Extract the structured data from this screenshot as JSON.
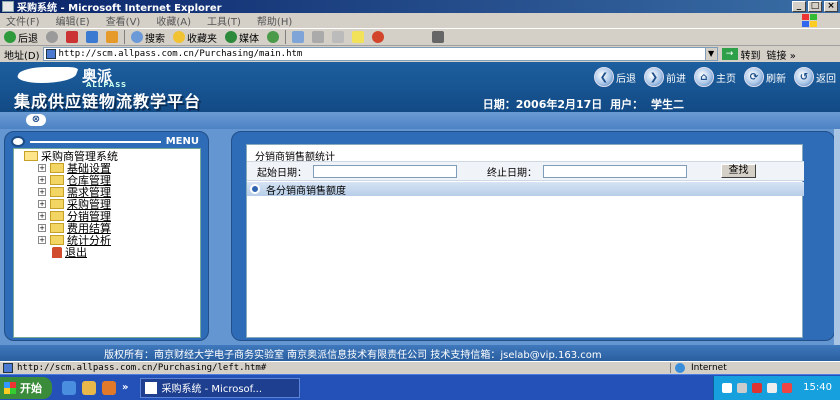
{
  "window": {
    "title": "采购系统 - Microsoft Internet Explorer",
    "min": "_",
    "max": "□",
    "close": "×"
  },
  "menubar": [
    "文件(F)",
    "编辑(E)",
    "查看(V)",
    "收藏(A)",
    "工具(T)",
    "帮助(H)"
  ],
  "toolbar": {
    "back": "后退",
    "search": "搜索",
    "favorites": "收藏夹",
    "media": "媒体"
  },
  "address": {
    "label": "地址(D)",
    "url": "http://scm.allpass.com.cn/Purchasing/main.htm",
    "go": "转到",
    "links": "链接",
    "go_glyph": "→",
    "dropdown_glyph": "▼",
    "more_glyph": "»"
  },
  "banner": {
    "logo_cn": "奥派",
    "logo_en": "ALLPASS",
    "platform": "集成供应链物流教学平台",
    "date_label": "日期：2006年2月17日",
    "user_label": "用户：",
    "user_name": "学生二",
    "nav": [
      {
        "label": "后退",
        "icon": "back-icon",
        "glyph": "❮"
      },
      {
        "label": "前进",
        "icon": "forward-icon",
        "glyph": "❯"
      },
      {
        "label": "主页",
        "icon": "home-icon",
        "glyph": "⌂"
      },
      {
        "label": "刷新",
        "icon": "refresh-icon",
        "glyph": "⟳"
      },
      {
        "label": "返回",
        "icon": "return-icon",
        "glyph": "↺"
      }
    ]
  },
  "close_strip": {
    "glyph": "⊗"
  },
  "left_menu": {
    "title": "MENU",
    "root": "采购商管理系统",
    "expander": "+",
    "items": [
      "基础设置",
      "仓库管理",
      "需求管理",
      "采购管理",
      "分销管理",
      "费用结算",
      "统计分析"
    ],
    "exit": "退出"
  },
  "main": {
    "heading": "分销商销售额统计",
    "start_label": "起始日期：",
    "start_value": "",
    "end_label": "终止日期：",
    "end_value": "",
    "search_button": "查找",
    "section_title": "各分销商销售额度"
  },
  "footer": {
    "copyright": "版权所有：南京财经大学电子商务实验室  南京奥派信息技术有限责任公司  技术支持信箱：jselab@vip.163.com"
  },
  "status": {
    "url": "http://scm.allpass.com.cn/Purchasing/left.htm#",
    "zone": "Internet"
  },
  "taskbar": {
    "start": "开始",
    "task": "采购系统 - Microsof...",
    "clock": "15:40",
    "chevron": "»"
  },
  "colors": {
    "banner": "#1d5f9f",
    "content_bg": "#6496d2",
    "panel": "#2e6cb8",
    "taskbar": "#2451b8"
  }
}
